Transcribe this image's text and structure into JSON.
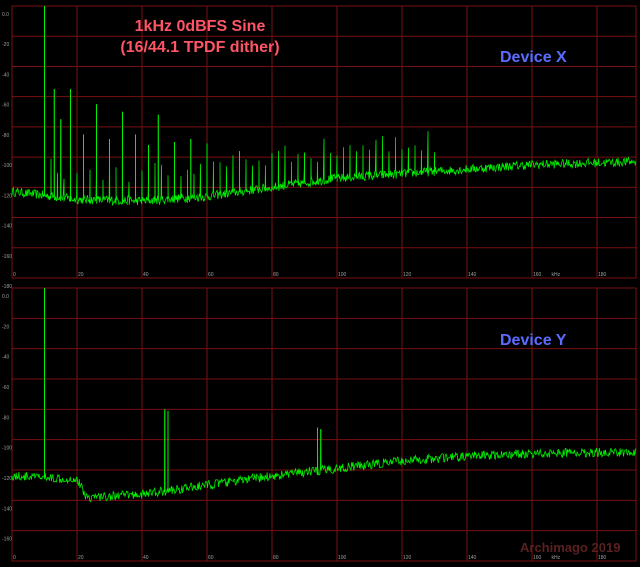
{
  "annotations": {
    "title_line1": "1kHz 0dBFS Sine",
    "title_line2": "(16/44.1 TPDF dither)",
    "watermark": "Archimago 2019"
  },
  "colors": {
    "background": "#000000",
    "grid": "#7a0f0f",
    "trace": "#00ee00",
    "title": "#ff5566",
    "device_label": "#5b6cff",
    "tick": "#9aa09a"
  },
  "chart_data": [
    {
      "type": "line",
      "name": "Device X",
      "xlabel": "kHz",
      "ylabel": "",
      "xlim": [
        0,
        19.2
      ],
      "ylim": [
        -180,
        0
      ],
      "x_ticks": [
        0,
        2,
        4,
        6,
        8,
        10,
        12,
        14,
        16,
        18
      ],
      "x_tick_labels": [
        "0",
        "20",
        "40",
        "60",
        "80",
        "100",
        "120",
        "140",
        "160",
        "180"
      ],
      "y_ticks": [
        0,
        -20,
        -40,
        -60,
        -80,
        -100,
        -120,
        -140,
        -160,
        -180
      ],
      "y_tick_labels": [
        "0.0",
        "-20",
        "-40",
        "-60",
        "-80",
        "-100",
        "-120",
        "-140",
        "-160",
        "-180"
      ],
      "fundamental": {
        "freq": 1.0,
        "level": 0
      },
      "noise_floor": [
        [
          0.1,
          -123
        ],
        [
          2,
          -128
        ],
        [
          4,
          -129
        ],
        [
          6,
          -126
        ],
        [
          8,
          -120
        ],
        [
          10,
          -114
        ],
        [
          12,
          -111
        ],
        [
          14,
          -108
        ],
        [
          16,
          -105
        ],
        [
          19.2,
          -103
        ]
      ],
      "harmonics": [
        [
          1.0,
          -10
        ],
        [
          1.3,
          -55
        ],
        [
          1.5,
          -75
        ],
        [
          1.8,
          -55
        ],
        [
          2.2,
          -85
        ],
        [
          2.6,
          -65
        ],
        [
          3.0,
          -88
        ],
        [
          3.4,
          -70
        ],
        [
          3.8,
          -85
        ],
        [
          4.2,
          -92
        ],
        [
          4.5,
          -72
        ],
        [
          5.0,
          -90
        ],
        [
          5.5,
          -88
        ],
        [
          6.0,
          -91
        ],
        [
          7.0,
          -96
        ],
        [
          8.0,
          -98
        ],
        [
          9.0,
          -97
        ],
        [
          10.0,
          -101
        ],
        [
          11.0,
          -104
        ],
        [
          12.0,
          -104
        ]
      ],
      "grid": true
    },
    {
      "type": "line",
      "name": "Device Y",
      "xlabel": "kHz",
      "ylabel": "",
      "xlim": [
        0,
        19.2
      ],
      "ylim": [
        -180,
        0
      ],
      "x_ticks": [
        0,
        2,
        4,
        6,
        8,
        10,
        12,
        14,
        16,
        18
      ],
      "x_tick_labels": [
        "0",
        "20",
        "40",
        "60",
        "80",
        "100",
        "120",
        "140",
        "160",
        "180"
      ],
      "y_ticks": [
        0,
        -20,
        -40,
        -60,
        -80,
        -100,
        -120,
        -140,
        -160,
        -180
      ],
      "y_tick_labels": [
        "0.0",
        "-20",
        "-40",
        "-60",
        "-80",
        "-100",
        "-120",
        "-140",
        "-160",
        "-180"
      ],
      "fundamental": {
        "freq": 1.0,
        "level": 0
      },
      "noise_floor": [
        [
          0.1,
          -124
        ],
        [
          2.0,
          -126
        ],
        [
          2.3,
          -138
        ],
        [
          4,
          -136
        ],
        [
          6,
          -130
        ],
        [
          8,
          -124
        ],
        [
          10,
          -119
        ],
        [
          12,
          -114
        ],
        [
          14,
          -111
        ],
        [
          16,
          -109
        ],
        [
          19.2,
          -108
        ]
      ],
      "spurs": [
        [
          4.7,
          -80
        ],
        [
          4.8,
          -81
        ],
        [
          9.4,
          -92
        ],
        [
          9.5,
          -93
        ]
      ],
      "grid": true
    }
  ]
}
